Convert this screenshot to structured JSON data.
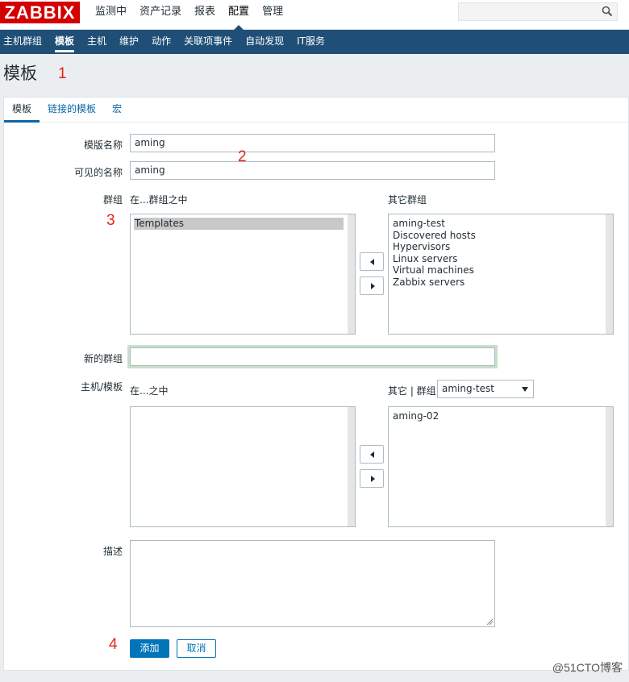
{
  "header": {
    "logo": "ZABBIX",
    "menu": [
      "监测中",
      "资产记录",
      "报表",
      "配置",
      "管理"
    ],
    "active_menu": "配置",
    "search": {
      "value": "",
      "placeholder": ""
    }
  },
  "subnav": [
    "主机群组",
    "模板",
    "主机",
    "维护",
    "动作",
    "关联项事件",
    "自动发现",
    "IT服务"
  ],
  "page_title": "模板",
  "annotations": [
    "1",
    "2",
    "3",
    "4"
  ],
  "tabs": [
    "模板",
    "链接的模板",
    "宏"
  ],
  "form": {
    "template_name": {
      "label": "模版名称",
      "value": "aming"
    },
    "visible_name": {
      "label": "可见的名称",
      "value": "aming"
    },
    "groups": {
      "label": "群组",
      "in_title": "在...群组之中",
      "other_title": "其它群组",
      "in_items": [
        "Templates"
      ],
      "other_items": [
        "aming-test",
        "Discovered hosts",
        "Hypervisors",
        "Linux servers",
        "Virtual machines",
        "Zabbix servers"
      ]
    },
    "new_group": {
      "label": "新的群组",
      "value": ""
    },
    "hosts": {
      "label": "主机/模板",
      "in_title": "在...之中",
      "other_title": "其它 | 群组",
      "group_select": "aming-test",
      "in_items": [],
      "other_items": [
        "aming-02"
      ]
    },
    "description": {
      "label": "描述",
      "value": ""
    },
    "buttons": {
      "add": "添加",
      "cancel": "取消"
    }
  },
  "watermark": "@51CTO博客"
}
